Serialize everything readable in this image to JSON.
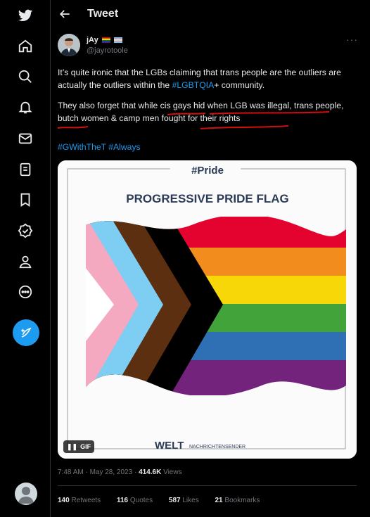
{
  "header": {
    "title": "Tweet"
  },
  "nav": [
    "twitter-logo",
    "home-icon",
    "search-icon",
    "notifications-icon",
    "messages-icon",
    "lists-icon",
    "bookmarks-icon",
    "verified-icon",
    "profile-icon",
    "more-icon",
    "compose-icon"
  ],
  "author": {
    "display_name": "jAy",
    "handle": "@jayrotoole"
  },
  "tweet": {
    "p1_before": "It’s quite ironic that the LGBs claiming that trans people are the outliers are actually the outliers within the ",
    "p1_link": "#LGBTQIA",
    "p1_after": "+ community.",
    "p2": "They also forget that while cis gays hid when LGB was illegal, trans people, butch women & camp men fought for their rights",
    "hashtag1": "#GWithTheT",
    "hashtag2": "#Always"
  },
  "media": {
    "label_top": "#Pride",
    "title": "PROGRESSIVE PRIDE FLAG",
    "brand": "WELT",
    "brand_sub": "NACHRICHTENSENDER",
    "gif_label": "GIF"
  },
  "meta": {
    "time": "7:48 AM · May 28, 2023 · ",
    "views_count": "414.6K",
    "views_label": " Views"
  },
  "stats": {
    "retweets": "140",
    "retweets_label": "Retweets",
    "quotes": "116",
    "quotes_label": "Quotes",
    "likes": "587",
    "likes_label": "Likes",
    "bookmarks": "21",
    "bookmarks_label": "Bookmarks"
  },
  "colors": {
    "accent": "#1d9bf0",
    "underline": "#d01010"
  }
}
